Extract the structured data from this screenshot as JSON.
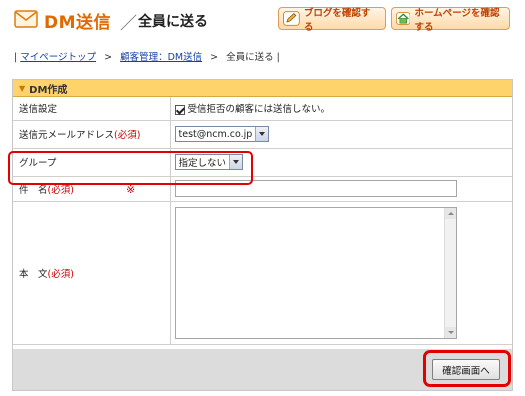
{
  "header": {
    "title": "DM送信",
    "separator": "／",
    "subtitle": "全員に送る",
    "blog_button": "ブログを確認する",
    "home_button": "ホームページを確認する"
  },
  "breadcrumb": {
    "items": [
      "マイページトップ",
      "顧客管理：DM送信",
      "全員に送る"
    ],
    "separator": ">"
  },
  "panel": {
    "title": "DM作成",
    "rows": {
      "send_setting": {
        "label": "送信設定",
        "checkbox_label": "受信拒否の顧客には送信しない。",
        "checked": true
      },
      "from_address": {
        "label": "送信元メールアドレス",
        "required": "(必須)",
        "value": "test@ncm.co.jp"
      },
      "group": {
        "label": "グループ",
        "value": "指定しない"
      },
      "subject": {
        "label": "件　名",
        "required": "(必須)",
        "mark": "※",
        "value": ""
      },
      "body": {
        "label": "本　文",
        "required": "(必須)",
        "value": ""
      }
    },
    "confirm_button": "確認画面へ"
  },
  "colors": {
    "accent": "#e06a00",
    "panel_header": "#ffd36b",
    "required": "#cc0000",
    "highlight": "#e20000"
  }
}
